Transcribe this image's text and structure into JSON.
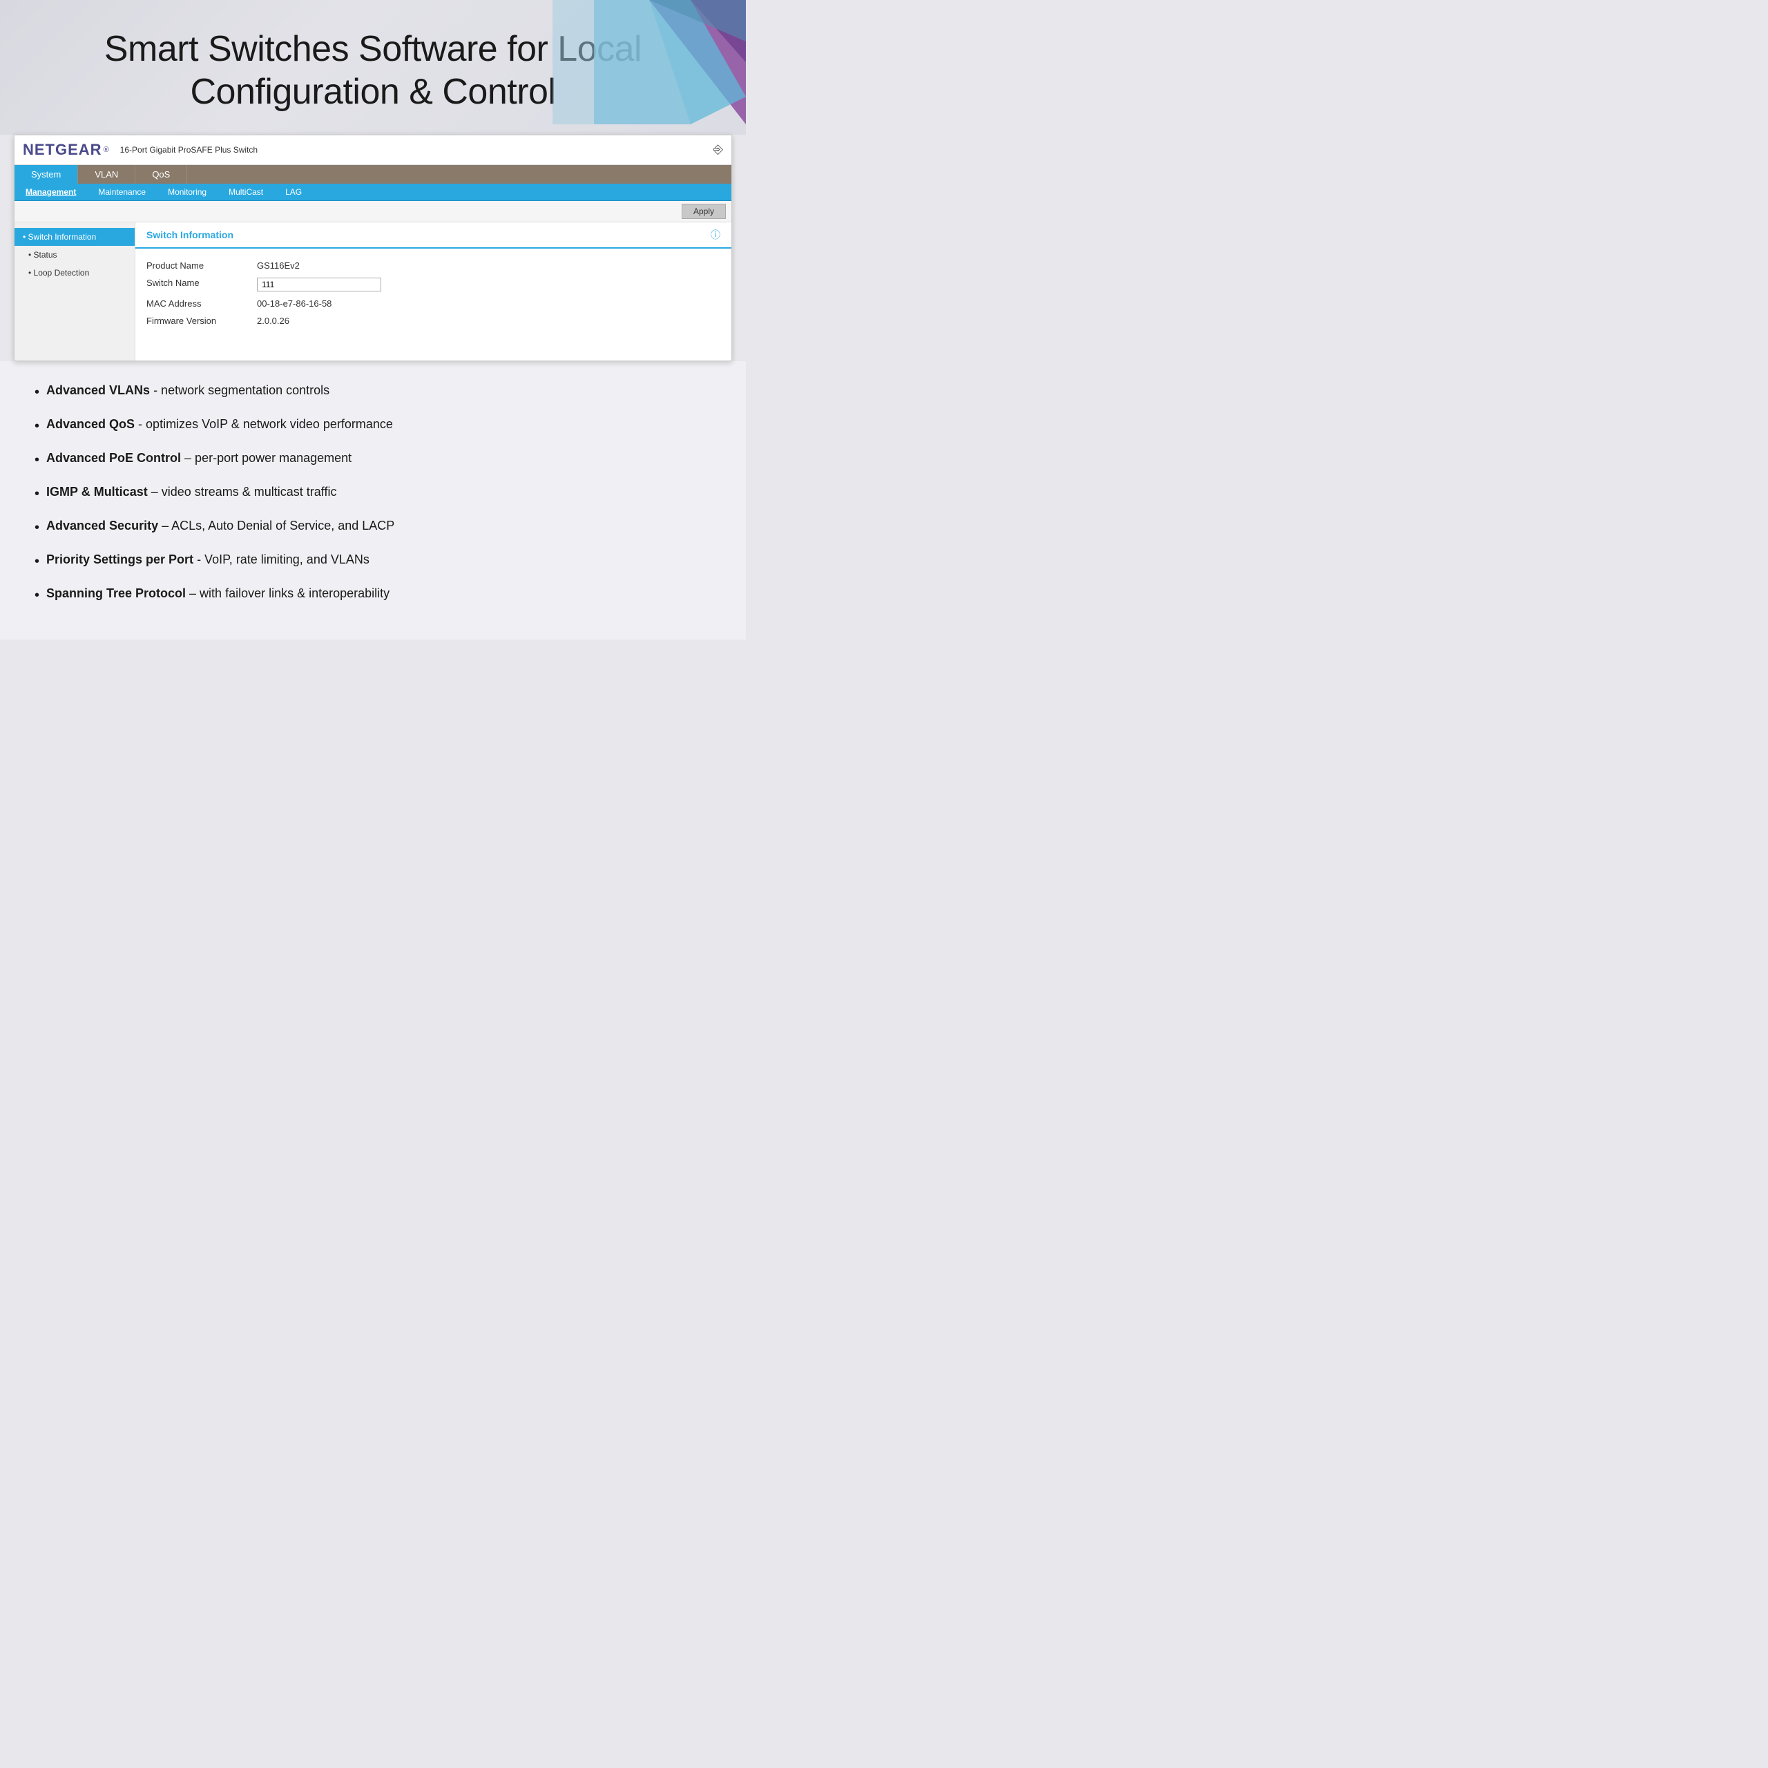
{
  "hero": {
    "title_line1": "Smart Switches Software for Local",
    "title_line2": "Configuration & Control"
  },
  "ui": {
    "brand": "NETGEAR",
    "brand_reg": "®",
    "device_title": "16-Port Gigabit ProSAFE Plus Switch",
    "nav_tabs": [
      {
        "label": "System",
        "active": true
      },
      {
        "label": "VLAN",
        "active": false
      },
      {
        "label": "QoS",
        "active": false
      }
    ],
    "subtabs": [
      {
        "label": "Management",
        "active": true
      },
      {
        "label": "Maintenance",
        "active": false
      },
      {
        "label": "Monitoring",
        "active": false
      },
      {
        "label": "MultiCast",
        "active": false
      },
      {
        "label": "LAG",
        "active": false
      }
    ],
    "apply_label": "Apply",
    "sidebar_items": [
      {
        "label": "• Switch Information",
        "active": true
      },
      {
        "label": "• Status",
        "active": false
      },
      {
        "label": "• Loop Detection",
        "active": false
      }
    ],
    "section_title": "Switch Information",
    "table_rows": [
      {
        "label": "Product Name",
        "value": "GS116Ev2",
        "is_input": false
      },
      {
        "label": "Switch Name",
        "value": "111",
        "is_input": true
      },
      {
        "label": "MAC Address",
        "value": "00-18-e7-86-16-58",
        "is_input": false
      },
      {
        "label": "Firmware Version",
        "value": "2.0.0.26",
        "is_input": false
      }
    ]
  },
  "features": [
    {
      "bold": "Advanced VLANs",
      "normal": " - network segmentation controls"
    },
    {
      "bold": "Advanced QoS",
      "normal": " - optimizes VoIP & network video performance"
    },
    {
      "bold": "Advanced PoE Control",
      "normal": " – per-port power management"
    },
    {
      "bold": "IGMP & Multicast",
      "normal": " – video streams & multicast traffic"
    },
    {
      "bold": "Advanced Security",
      "normal": " – ACLs, Auto Denial of Service, and LACP"
    },
    {
      "bold": "Priority Settings per Port",
      "normal": " - VoIP, rate limiting, and VLANs"
    },
    {
      "bold": "Spanning Tree Protocol",
      "normal": " – with failover links & interoperability"
    }
  ]
}
